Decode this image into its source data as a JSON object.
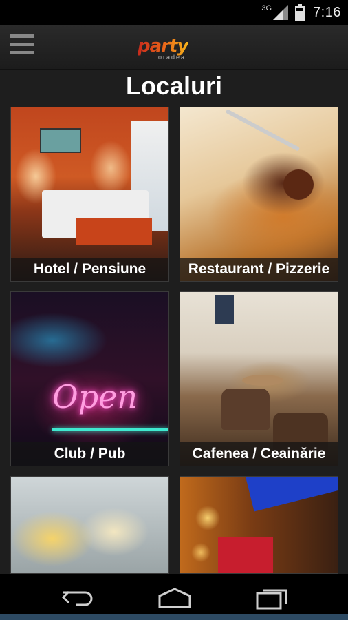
{
  "status_bar": {
    "network": "3G",
    "time": "7:16"
  },
  "app_bar": {
    "logo_text": "party",
    "logo_subtext": "oradea"
  },
  "page": {
    "title": "Localuri"
  },
  "categories": [
    {
      "label": "Hotel / Pensiune"
    },
    {
      "label": "Restaurant / Pizzerie"
    },
    {
      "label": "Club / Pub"
    },
    {
      "label": "Cafenea / Ceainărie"
    },
    {
      "label": ""
    },
    {
      "label": ""
    }
  ],
  "colors": {
    "accent_orange": "#e8621a",
    "background": "#1e1e1e"
  },
  "icons": [
    "menu-icon",
    "signal-icon",
    "battery-icon",
    "back-icon",
    "home-icon",
    "recent-apps-icon"
  ]
}
